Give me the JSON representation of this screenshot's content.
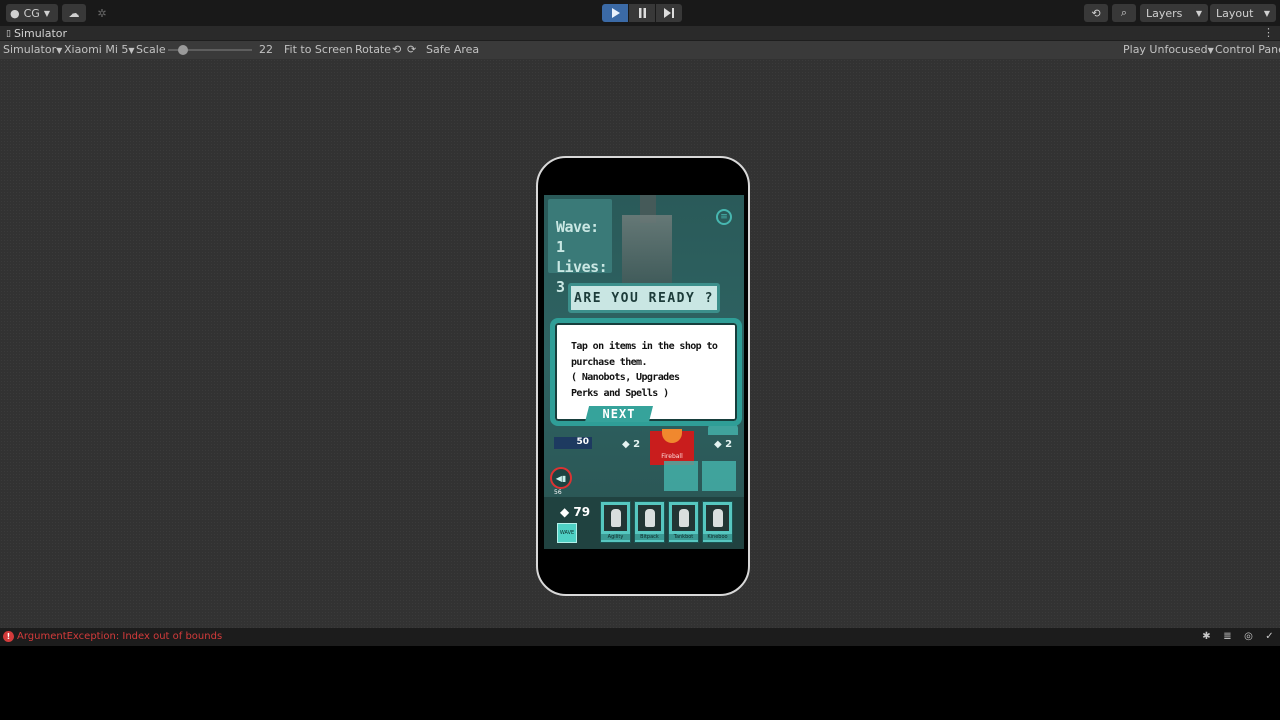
{
  "toolbar": {
    "account_label": "CG",
    "layers_label": "Layers",
    "layout_label": "Layout"
  },
  "simulator": {
    "tab_title": "Simulator",
    "mode_label": "Simulator",
    "device_label": "Xiaomi Mi 5",
    "scale_label": "Scale",
    "scale_value": "22",
    "fit_to_screen": "Fit to Screen",
    "rotate_label": "Rotate",
    "safe_area_label": "Safe Area",
    "play_mode_label": "Play Unfocused",
    "control_panel_label": "Control Panel"
  },
  "game": {
    "wave": "Wave: 1",
    "lives": "Lives: 3",
    "ready_banner": "ARE YOU READY ?",
    "tooltip_text": "Tap on items in the shop to\npurchase them.\n( Nanobots, Upgrades\nPerks and Spells )",
    "next_label": "NEXT",
    "coins": "50",
    "cost_left": "2",
    "cost_right": "2",
    "fireball_label": "Fireball",
    "timer_label": "56",
    "gems": "79",
    "gem_button": "WAVE",
    "bots": [
      {
        "name": "Agility"
      },
      {
        "name": "Bitpack"
      },
      {
        "name": "Tankbot"
      },
      {
        "name": "Kineboo"
      }
    ]
  },
  "status": {
    "error_text": "ArgumentException: Index out of bounds"
  }
}
